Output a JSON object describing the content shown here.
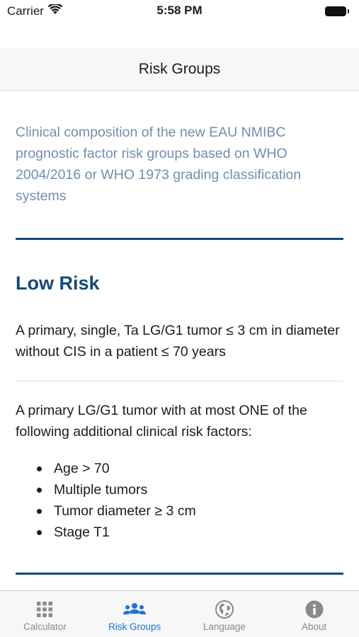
{
  "status_bar": {
    "carrier": "Carrier",
    "time": "5:58 PM"
  },
  "nav": {
    "title": "Risk Groups"
  },
  "intro": "Clinical composition of the new EAU NMIBC prognostic factor risk groups based on WHO 2004/2016 or WHO 1973 grading classification systems",
  "low_risk": {
    "title": "Low Risk",
    "criterion_1": "A primary, single, Ta LG/G1 tumor ≤ 3 cm in diameter without CIS in a patient ≤ 70 years",
    "criterion_2": "A primary LG/G1 tumor with at most ONE of the following additional clinical risk factors:",
    "factors": [
      "Age > 70",
      "Multiple tumors",
      "Tumor diameter ≥ 3 cm",
      "Stage T1"
    ]
  },
  "tabs": [
    {
      "label": "Calculator",
      "icon": "grid-icon",
      "active": false
    },
    {
      "label": "Risk Groups",
      "icon": "people-icon",
      "active": true
    },
    {
      "label": "Language",
      "icon": "globe-icon",
      "active": false
    },
    {
      "label": "About",
      "icon": "info-icon",
      "active": false
    }
  ],
  "colors": {
    "accent": "#1a73e8",
    "heading": "#124a7c",
    "intro": "#6f8fae",
    "inactive_tab": "#8a8a8e"
  }
}
